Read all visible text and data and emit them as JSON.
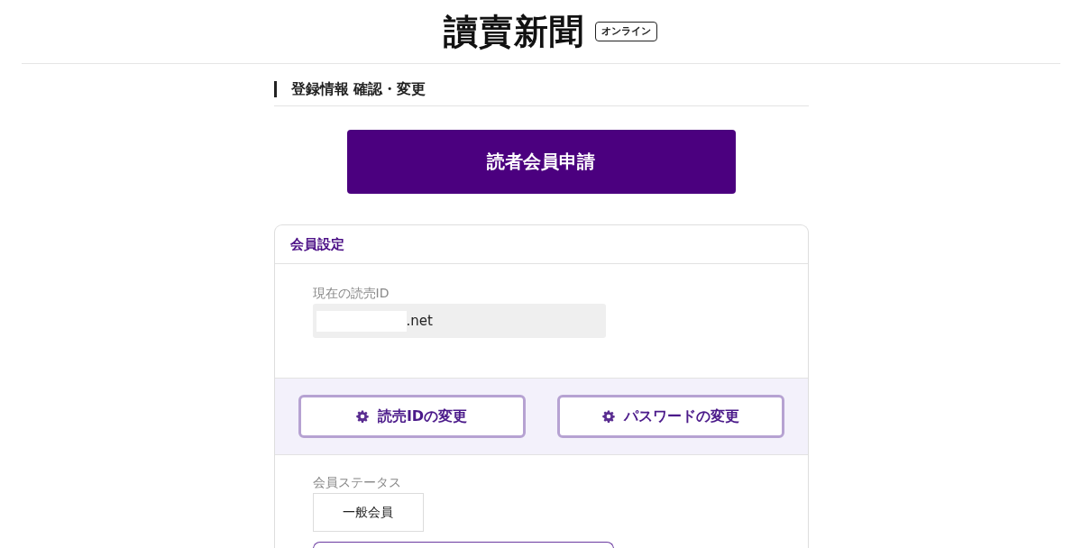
{
  "header": {
    "logo": "讀賣新聞",
    "badge": "オンライン"
  },
  "page_heading": "登録情報 確認・変更",
  "primary_button": {
    "label": "読者会員申請"
  },
  "card": {
    "title": "会員設定",
    "current_id": {
      "label": "現在の読売ID",
      "value": ".net",
      "redacted": true
    },
    "actions": [
      {
        "label": "読売IDの変更"
      },
      {
        "label": "パスワードの変更"
      }
    ],
    "status": {
      "label": "会員ステータス",
      "value": "一般会員"
    }
  }
}
